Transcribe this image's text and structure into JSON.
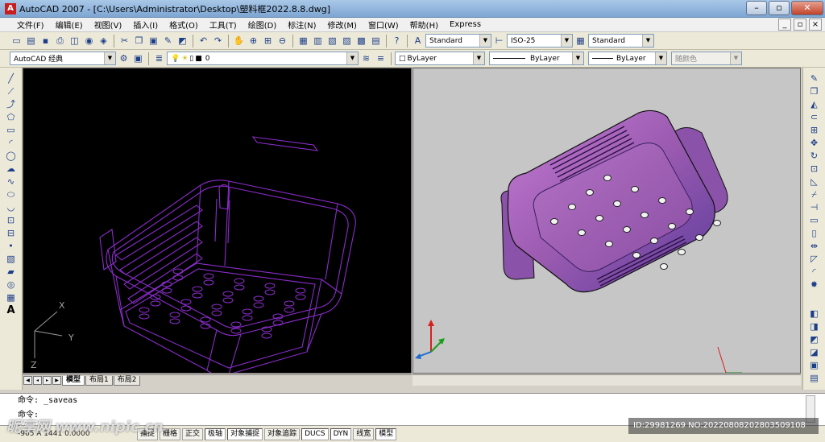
{
  "window": {
    "title": "AutoCAD 2007 - [C:\\Users\\Administrator\\Desktop\\塑料框2022.8.8.dwg]",
    "app_icon": "autocad-logo-icon"
  },
  "menu": [
    "文件(F)",
    "编辑(E)",
    "视图(V)",
    "插入(I)",
    "格式(O)",
    "工具(T)",
    "绘图(D)",
    "标注(N)",
    "修改(M)",
    "窗口(W)",
    "帮助(H)",
    "Express"
  ],
  "toolbar": {
    "text_style": "Standard",
    "dim_style": "ISO-25",
    "table_style": "Standard",
    "workspace": "AutoCAD 经典",
    "layer": "0",
    "color": "ByLayer",
    "linetype": "ByLayer",
    "lineweight": "ByLayer",
    "plot_style": "随颜色"
  },
  "viewport_left": {
    "axis_x": "X",
    "axis_y": "Y",
    "axis_z": "Z",
    "wire_color": "#8a2cc9"
  },
  "viewport_right": {
    "body_color": "#9a5ab0"
  },
  "layout_tabs": [
    "模型",
    "布局1",
    "布局2"
  ],
  "command": {
    "line1": "命令: _saveas",
    "line2": "命令:"
  },
  "status": {
    "coords": "-965  A  1441  0.0000",
    "buttons": [
      "捕捉",
      "栅格",
      "正交",
      "极轴",
      "对象捕捉",
      "对象追踪",
      "DUCS",
      "DYN",
      "线宽",
      "模型"
    ]
  },
  "watermark": {
    "left": "昵享网 www.nipic.cn",
    "right": "ID:29981269 NO:20220808202803509108"
  }
}
